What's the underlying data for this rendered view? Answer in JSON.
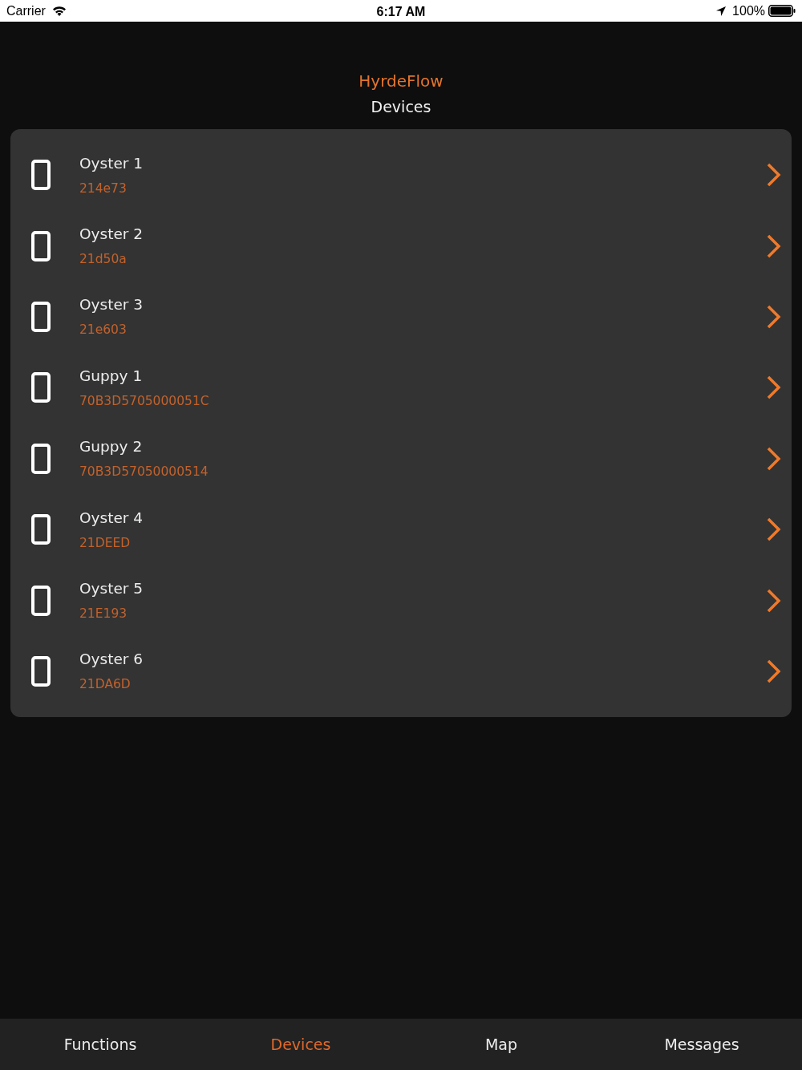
{
  "status_bar": {
    "carrier": "Carrier",
    "time": "6:17 AM",
    "battery": "100%"
  },
  "header": {
    "app_name": "HyrdeFlow",
    "title": "Devices"
  },
  "devices": [
    {
      "name": "Oyster 1",
      "id": "214e73"
    },
    {
      "name": "Oyster 2",
      "id": "21d50a"
    },
    {
      "name": "Oyster 3",
      "id": "21e603"
    },
    {
      "name": "Guppy 1",
      "id": "70B3D5705000051C"
    },
    {
      "name": "Guppy 2",
      "id": "70B3D57050000514"
    },
    {
      "name": "Oyster 4",
      "id": "21DEED"
    },
    {
      "name": "Oyster 5",
      "id": "21E193"
    },
    {
      "name": "Oyster 6",
      "id": "21DA6D"
    }
  ],
  "tab_bar": [
    {
      "label": "Functions",
      "selected": false
    },
    {
      "label": "Devices",
      "selected": true
    },
    {
      "label": "Map",
      "selected": false
    },
    {
      "label": "Messages",
      "selected": false
    }
  ]
}
